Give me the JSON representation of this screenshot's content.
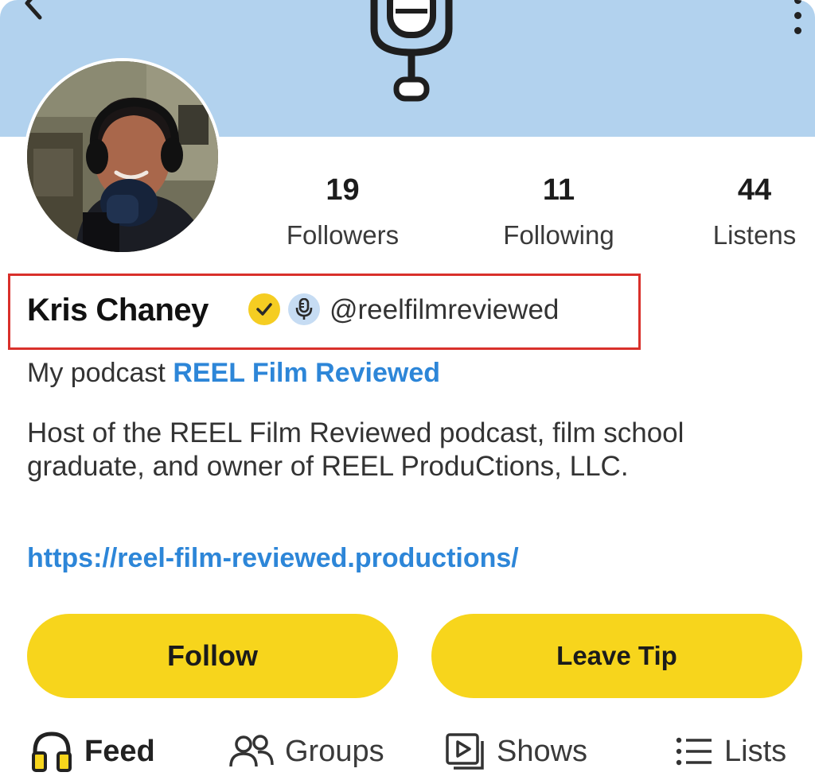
{
  "profile": {
    "name": "Kris Chaney",
    "handle": "@reelfilmreviewed",
    "podcast_prefix": "My podcast",
    "podcast_name": "REEL Film Reviewed",
    "bio": "Host of the REEL Film Reviewed podcast, film school graduate, and owner of REEL ProduCtions, LLC.",
    "url": "https://reel-film-reviewed.productions/"
  },
  "stats": [
    {
      "value": "19",
      "label": "Followers"
    },
    {
      "value": "11",
      "label": "Following"
    },
    {
      "value": "44",
      "label": "Listens"
    }
  ],
  "buttons": {
    "follow": "Follow",
    "tip": "Leave Tip"
  },
  "tabs": [
    {
      "label": "Feed",
      "icon": "headphones-icon",
      "active": true
    },
    {
      "label": "Groups",
      "icon": "people-icon",
      "active": false
    },
    {
      "label": "Shows",
      "icon": "shows-icon",
      "active": false
    },
    {
      "label": "Lists",
      "icon": "list-icon",
      "active": false
    }
  ],
  "colors": {
    "cover": "#b2d2ee",
    "button": "#f7d51c",
    "link": "#2d86d8",
    "verified_badge": "#f5cd22",
    "podcaster_badge": "#c6dcf3",
    "highlight_box": "#d9302b"
  },
  "icons": {
    "header_logo": "microphone-logo",
    "back": "back-arrow-icon",
    "menu": "more-vertical-icon",
    "verified": "checkmark-badge-icon",
    "podcaster": "microphone-badge-icon"
  }
}
